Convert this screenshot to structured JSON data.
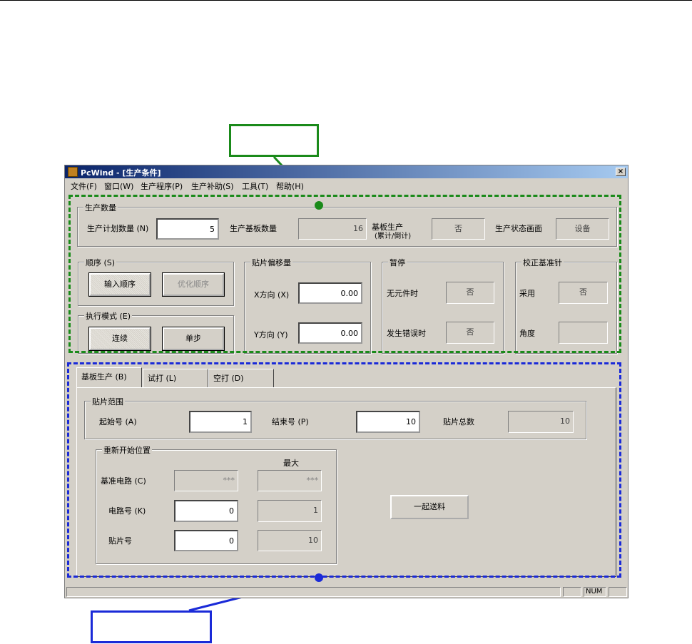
{
  "window": {
    "title": "PcWind - [生产条件]",
    "close_glyph": "×",
    "menu": [
      "文件(F)",
      "窗口(W)",
      "生产程序(P)",
      "生产补助(S)",
      "工具(T)",
      "帮助(H)"
    ]
  },
  "production_qty": {
    "group_label": "生产数量",
    "plan_label": "生产计划数量 (N)",
    "plan_value": "5",
    "board_count_label": "生产基板数量",
    "board_count_value": "16",
    "board_prod_label_1": "基板生产",
    "board_prod_label_2": "(累计/倒计)",
    "board_prod_value": "否",
    "status_screen_label": "生产状态画面",
    "status_screen_value": "设备"
  },
  "order": {
    "group_label": "顺序 (S)",
    "input_btn": "输入顺序",
    "optimize_btn": "优化顺序"
  },
  "exec_mode": {
    "group_label": "执行模式 (E)",
    "continuous_btn": "连续",
    "step_btn": "单步"
  },
  "offset": {
    "group_label": "贴片偏移量",
    "x_label": "X方向 (X)",
    "x_value": "0.00",
    "y_label": "Y方向 (Y)",
    "y_value": "0.00"
  },
  "pause": {
    "group_label": "暂停",
    "no_part_label": "无元件时",
    "no_part_value": "否",
    "error_label": "发生错误时",
    "error_value": "否"
  },
  "calib": {
    "group_label": "校正基准针",
    "use_label": "采用",
    "use_value": "否",
    "angle_label": "角度",
    "angle_value": ""
  },
  "tabs": [
    "基板生产 (B)",
    "试打 (L)",
    "空打 (D)"
  ],
  "mount_range": {
    "group_label": "贴片范围",
    "start_label": "起始号 (A)",
    "start_value": "1",
    "end_label": "结束号 (P)",
    "end_value": "10",
    "total_label": "贴片总数",
    "total_value": "10"
  },
  "restart": {
    "group_label": "重新开始位置",
    "max_header": "最大",
    "ref_circuit_label": "基准电路 (C)",
    "ref_circuit_value": "***",
    "ref_circuit_max": "***",
    "circuit_no_label": "电路号 (K)",
    "circuit_no_value": "0",
    "circuit_no_max": "1",
    "mount_no_label": "贴片号",
    "mount_no_value": "0",
    "mount_no_max": "10"
  },
  "feed_btn": "一起送料",
  "statusbar": {
    "num": "NUM"
  },
  "colors": {
    "green_dash": "#1a8a1a",
    "blue_dash": "#1a2ad8",
    "window_face": "#d4d0c8"
  }
}
